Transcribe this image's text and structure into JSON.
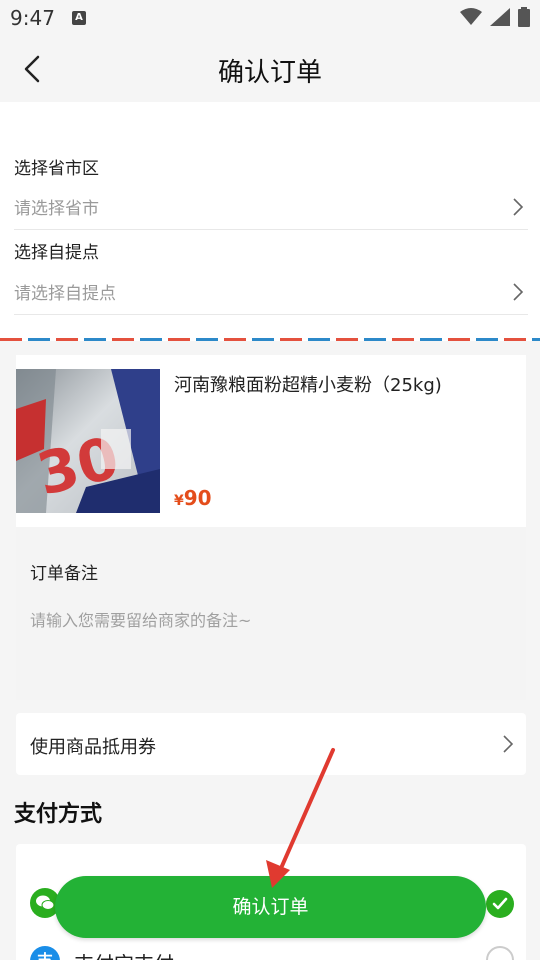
{
  "status_bar": {
    "time": "9:47",
    "badge": "A"
  },
  "nav": {
    "title": "确认订单"
  },
  "address": {
    "region_label": "选择省市区",
    "region_placeholder": "请选择省市",
    "pickup_label": "选择自提点",
    "pickup_placeholder": "请选择自提点"
  },
  "product": {
    "name": "河南豫粮面粉超精小麦粉（25kg)",
    "currency": "¥",
    "price": "90",
    "image_text": "30"
  },
  "note": {
    "label": "订单备注",
    "placeholder": "请输入您需要留给商家的备注~"
  },
  "coupon": {
    "label": "使用商品抵用券"
  },
  "payment": {
    "title": "支付方式",
    "alipay_label": "支付宝支付",
    "alipay_glyph": "支"
  },
  "confirm": {
    "label": "确认订单"
  },
  "colors": {
    "primary_green": "#23b236",
    "price_orange": "#e44d1b",
    "alipay_blue": "#1a8ee8",
    "annotation_red": "#e03a30"
  }
}
